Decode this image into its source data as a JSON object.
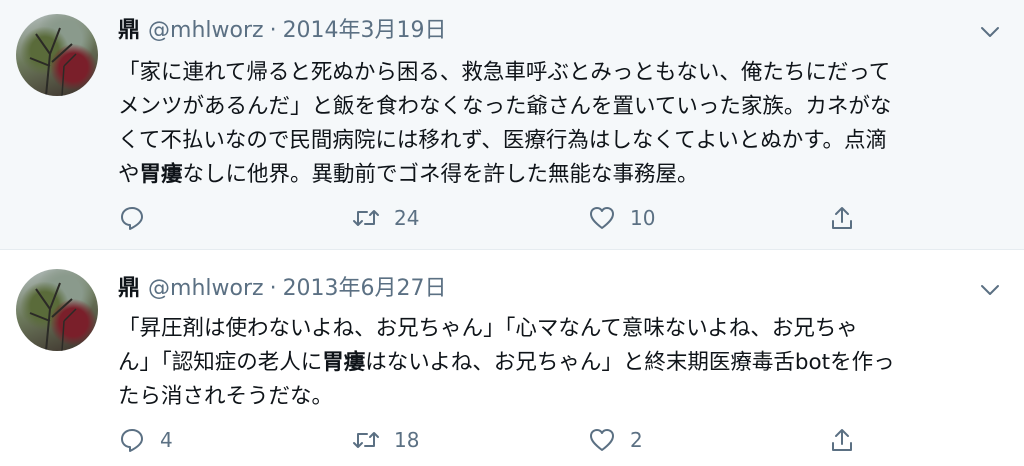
{
  "tweets": [
    {
      "name": "鼎",
      "handle": "@mhlworz",
      "separator": "·",
      "date": "2014年3月19日",
      "text_lines": [
        "「家に連れて帰ると死ぬから困る、救急車呼ぶとみっともない、俺たちにだって",
        "メンツがあるんだ」と飯を食わなくなった爺さんを置いていった家族。カネがな",
        "くて不払いなので民間病院には移れず、医療行為はしなくてよいとぬかす。点滴"
      ],
      "last_line": {
        "before": "や",
        "highlight": "胃瘻",
        "after": "なしに他界。異動前でゴネ得を許した無能な事務屋。"
      },
      "actions": {
        "reply": "",
        "retweet": "24",
        "like": "10"
      }
    },
    {
      "name": "鼎",
      "handle": "@mhlworz",
      "separator": "·",
      "date": "2013年6月27日",
      "line1": "「昇圧剤は使わないよね、お兄ちゃん」「心マなんて意味ないよね、お兄ちゃ",
      "line2": {
        "before": "ん」「認知症の老人に",
        "highlight": "胃瘻",
        "after": "はないよね、お兄ちゃん」と終末期医療毒舌botを作っ"
      },
      "line3": "たら消されそうだな。",
      "actions": {
        "reply": "4",
        "retweet": "18",
        "like": "2"
      }
    }
  ],
  "icons": [
    "avatar",
    "chevron-down-icon",
    "reply-icon",
    "retweet-icon",
    "like-icon",
    "share-icon"
  ],
  "colors": {
    "muted": "#5b7083",
    "text": "#0f1419",
    "highlight_bg": "#f5f8fa"
  }
}
